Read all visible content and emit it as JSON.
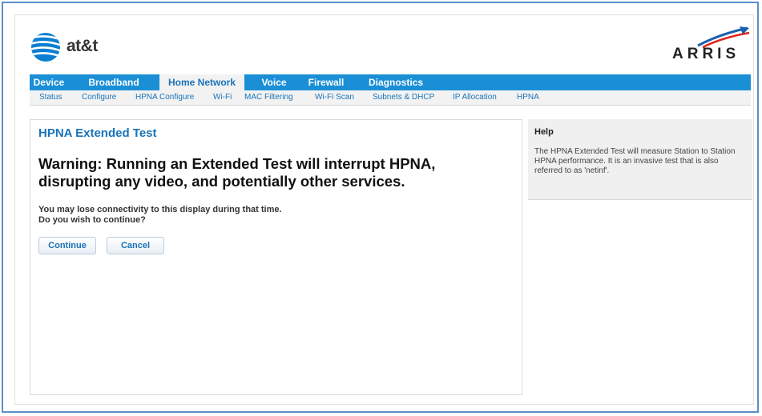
{
  "brand": {
    "att_logo_text": "at&t",
    "arris_logo_text": "ARRIS"
  },
  "nav": {
    "tabs": [
      {
        "label": "Device",
        "active": false
      },
      {
        "label": "Broadband",
        "active": false
      },
      {
        "label": "Home Network",
        "active": true
      },
      {
        "label": "Voice",
        "active": false
      },
      {
        "label": "Firewall",
        "active": false
      },
      {
        "label": "Diagnostics",
        "active": false
      }
    ],
    "subtabs": [
      {
        "label": "Status"
      },
      {
        "label": "Configure"
      },
      {
        "label": "HPNA Configure"
      },
      {
        "label": "Wi-Fi"
      },
      {
        "label": "MAC Filtering"
      },
      {
        "label": "Wi-Fi Scan"
      },
      {
        "label": "Subnets & DHCP"
      },
      {
        "label": "IP Allocation"
      },
      {
        "label": "HPNA"
      }
    ]
  },
  "main": {
    "title": "HPNA Extended Test",
    "warning": "Warning: Running an Extended Test will interrupt HPNA, disrupting any video, and potentially other services.",
    "message_line1": "You may lose connectivity to this display during that time.",
    "message_line2": "Do you wish to continue?",
    "continue_label": "Continue",
    "cancel_label": "Cancel"
  },
  "help": {
    "title": "Help",
    "text": "The HPNA Extended Test will measure Station to Station HPNA performance. It is an invasive test that is also referred to as 'netinf'."
  },
  "colors": {
    "nav_blue": "#1a8fd6",
    "link_blue": "#1a73b8",
    "frame_blue": "#5b8fc9",
    "arris_red": "#e2231a"
  }
}
